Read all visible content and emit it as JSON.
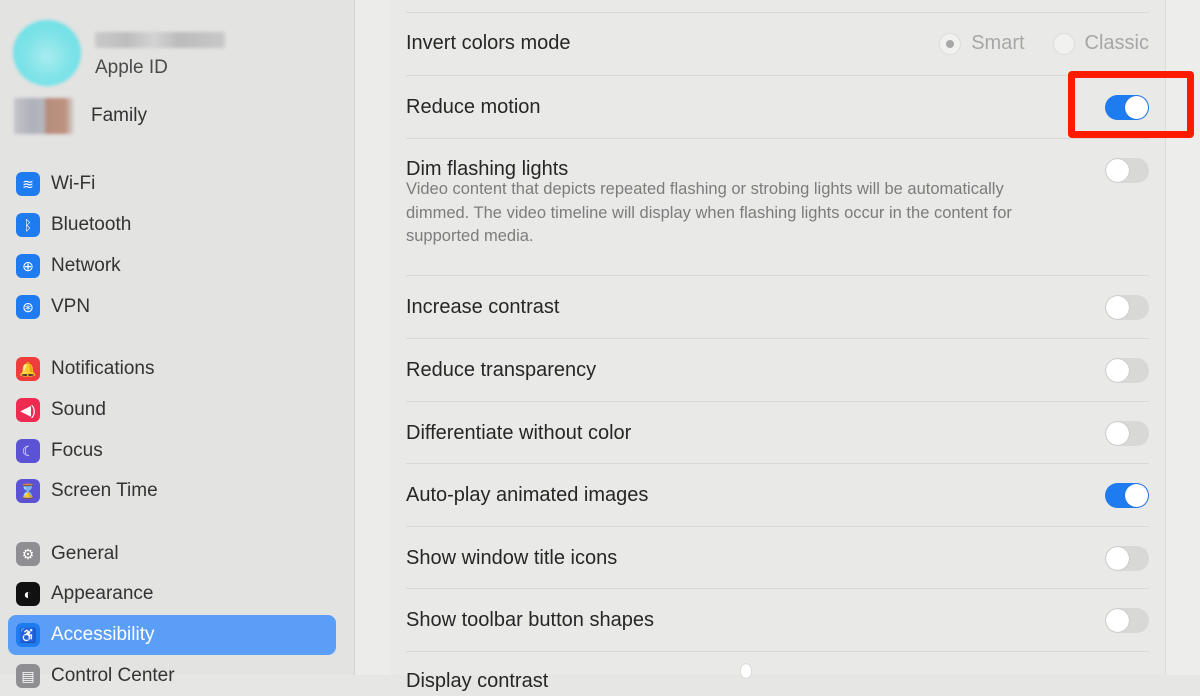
{
  "sidebar": {
    "account": {
      "name_redacted": "",
      "apple_id_label": "Apple ID",
      "family_label": "Family"
    },
    "items": [
      {
        "label": "Wi-Fi",
        "icon": "wifi-icon",
        "color": "#1f7bf0",
        "glyph": "≋"
      },
      {
        "label": "Bluetooth",
        "icon": "bluetooth-icon",
        "color": "#1f7bf0",
        "glyph": "ᛒ"
      },
      {
        "label": "Network",
        "icon": "network-globe-icon",
        "color": "#1f7bf0",
        "glyph": "⊕"
      },
      {
        "label": "VPN",
        "icon": "vpn-globe-icon",
        "color": "#1f7bf0",
        "glyph": "⊛"
      },
      {
        "label": "Notifications",
        "icon": "bell-icon",
        "color": "#ef3d3d",
        "glyph": "🔔"
      },
      {
        "label": "Sound",
        "icon": "speaker-icon",
        "color": "#ef2b52",
        "glyph": "◀)"
      },
      {
        "label": "Focus",
        "icon": "moon-icon",
        "color": "#5b52d6",
        "glyph": "☾"
      },
      {
        "label": "Screen Time",
        "icon": "hourglass-icon",
        "color": "#5b52d6",
        "glyph": "⌛"
      },
      {
        "label": "General",
        "icon": "gear-icon",
        "color": "#8e8e93",
        "glyph": "⚙"
      },
      {
        "label": "Appearance",
        "icon": "appearance-icon",
        "color": "#111111",
        "glyph": "◐"
      },
      {
        "label": "Accessibility",
        "icon": "accessibility-icon",
        "color": "#1f7bf0",
        "glyph": "♿"
      },
      {
        "label": "Control Center",
        "icon": "control-center-icon",
        "color": "#8e8e93",
        "glyph": "▤"
      }
    ],
    "selected": "Accessibility"
  },
  "settings": {
    "invert_colors": {
      "label": "Invert colors mode",
      "options": [
        "Smart",
        "Classic"
      ],
      "selected": "Smart",
      "enabled": false
    },
    "rows": [
      {
        "label": "Reduce motion",
        "on": true,
        "highlighted": true
      },
      {
        "label": "Dim flashing lights",
        "on": false,
        "description": "Video content that depicts repeated flashing or strobing lights will be automatically dimmed. The video timeline will display when flashing lights occur in the content for supported media."
      },
      {
        "label": "Increase contrast",
        "on": false
      },
      {
        "label": "Reduce transparency",
        "on": false
      },
      {
        "label": "Differentiate without color",
        "on": false
      },
      {
        "label": "Auto-play animated images",
        "on": true
      },
      {
        "label": "Show window title icons",
        "on": false
      },
      {
        "label": "Show toolbar button shapes",
        "on": false
      },
      {
        "label": "Display contrast",
        "partial": true
      }
    ]
  },
  "annotation": {
    "color": "#ff1a00",
    "target": "Reduce motion toggle"
  }
}
